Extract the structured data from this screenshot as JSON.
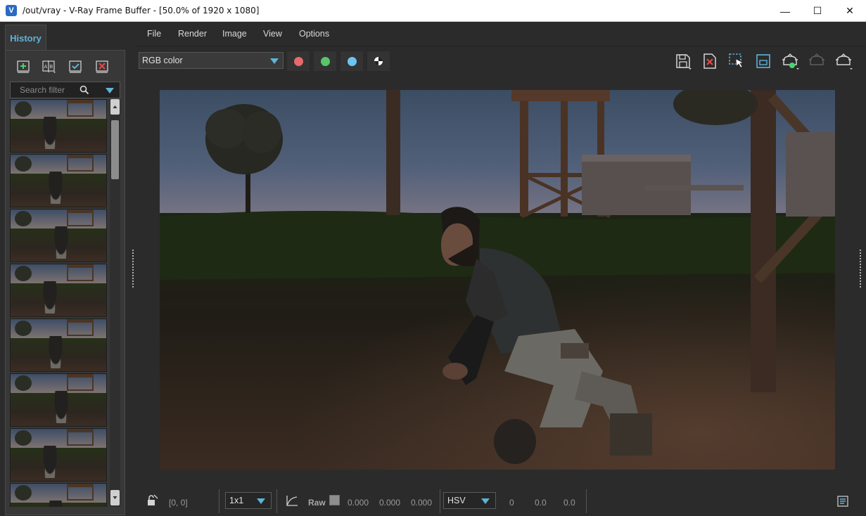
{
  "window": {
    "title": "/out/vray - V-Ray Frame Buffer - [50.0% of 1920 x 1080]",
    "app_icon_letter": "V",
    "minimize_glyph": "—",
    "maximize_glyph": "☐",
    "close_glyph": "✕"
  },
  "history": {
    "tab_label": "History",
    "toolbar": [
      "add-to-history-icon",
      "ab-compare-icon",
      "load-history-icon",
      "clear-history-icon"
    ],
    "search_placeholder": "Search filter",
    "thumbnail_count": 8
  },
  "menu": {
    "items": [
      "File",
      "Render",
      "Image",
      "View",
      "Options"
    ]
  },
  "toolbar": {
    "channel": "RGB color",
    "channel_colors": {
      "red": "#e8696a",
      "green": "#57c76a",
      "blue": "#6cc4f2"
    },
    "right_icons": [
      "save-image-icon",
      "clear-image-icon",
      "region-render-icon",
      "lens-effects-icon",
      "render-interactive-icon",
      "stop-render-icon",
      "render-icon"
    ]
  },
  "status": {
    "coords": "[0, 0]",
    "sample_size": "1x1",
    "raw_label": "Raw",
    "rgb_values": [
      "0.000",
      "0.000",
      "0.000"
    ],
    "color_mode": "HSV",
    "hsv_values": [
      "0",
      "0.0",
      "0.0"
    ]
  }
}
